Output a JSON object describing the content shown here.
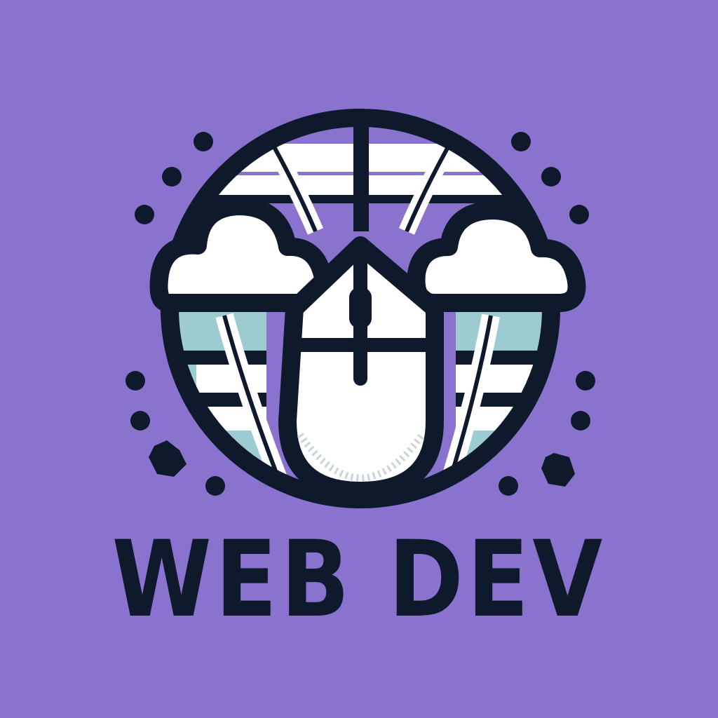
{
  "logo": {
    "wordmark": "WEB DEV",
    "icons": [
      "globe-icon",
      "cloud-icon",
      "mouse-icon",
      "sparkle-icon"
    ]
  },
  "colors": {
    "background": "#8A72CF",
    "outline": "#0E1A2B",
    "fill": "#FFFFFF",
    "accent": "#9CCBD2",
    "globe_purple": "#8A72CF"
  }
}
